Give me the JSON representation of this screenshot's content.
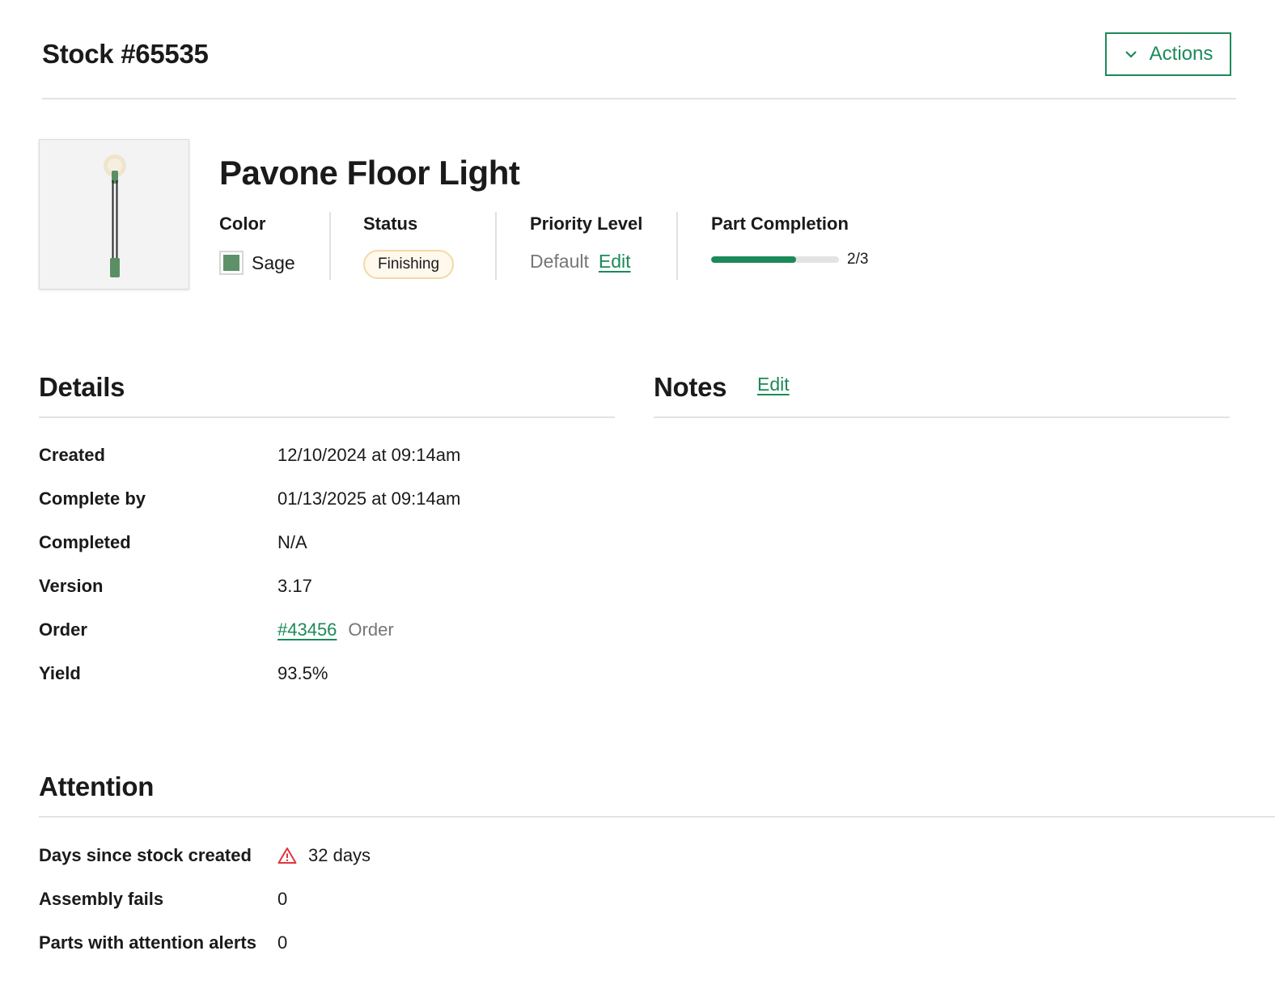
{
  "header": {
    "title": "Stock #65535",
    "actions_label": "Actions"
  },
  "product": {
    "name": "Pavone Floor Light",
    "color": {
      "label": "Color",
      "value": "Sage",
      "swatch": "#5f9169"
    },
    "status": {
      "label": "Status",
      "value": "Finishing"
    },
    "priority": {
      "label": "Priority Level",
      "value": "Default",
      "edit_label": "Edit"
    },
    "part_completion": {
      "label": "Part Completion",
      "completed": 2,
      "total": 3,
      "text": "2/3"
    }
  },
  "details": {
    "title": "Details",
    "rows": [
      {
        "label": "Created",
        "value": "12/10/2024 at 09:14am"
      },
      {
        "label": "Complete by",
        "value": "01/13/2025 at 09:14am"
      },
      {
        "label": "Completed",
        "value": "N/A"
      },
      {
        "label": "Version",
        "value": "3.17"
      },
      {
        "label": "Order",
        "value": "#43456",
        "suffix": "Order"
      },
      {
        "label": "Yield",
        "value": "93.5%"
      }
    ]
  },
  "notes": {
    "title": "Notes",
    "edit_label": "Edit"
  },
  "attention": {
    "title": "Attention",
    "rows": [
      {
        "label": "Days since stock created",
        "value": "32 days",
        "icon": "warning-icon"
      },
      {
        "label": "Assembly fails",
        "value": "0"
      },
      {
        "label": "Parts with attention alerts",
        "value": "0"
      }
    ]
  },
  "colors": {
    "accent": "#1b8a5a",
    "warning": "#e0343c",
    "status_badge_border": "#f3d9a8",
    "status_badge_bg": "#fff8ec"
  }
}
